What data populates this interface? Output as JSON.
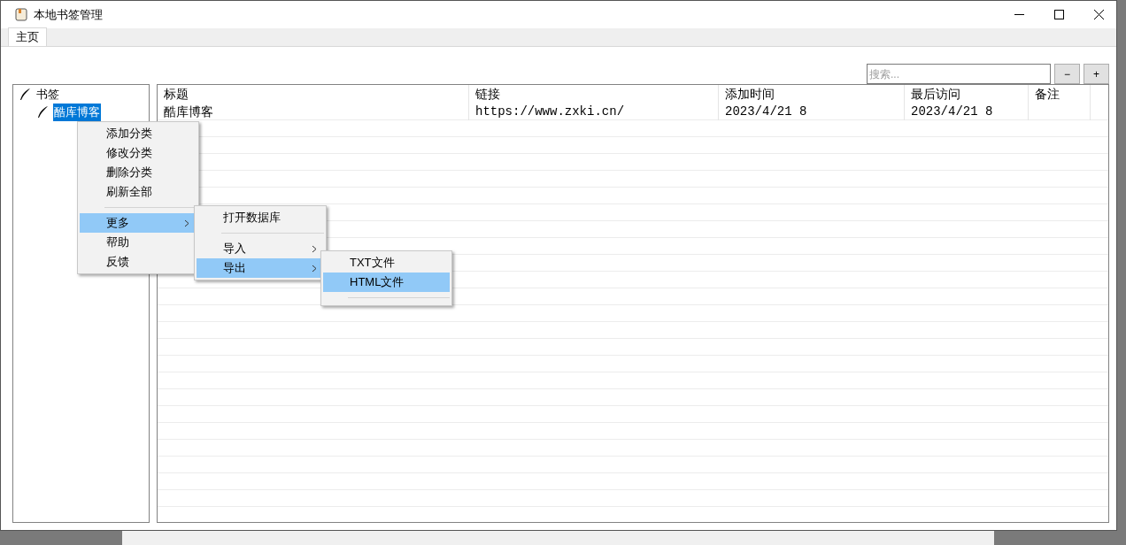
{
  "window": {
    "title": "本地书签管理"
  },
  "tabs": [
    {
      "label": "主页",
      "selected": true
    }
  ],
  "search": {
    "placeholder": "搜索..."
  },
  "toolbar_buttons": [
    "−",
    "+"
  ],
  "tree": [
    {
      "label": "书签",
      "selected": false,
      "children": [
        {
          "label": "酷库博客",
          "selected": true
        }
      ]
    }
  ],
  "table": {
    "columns": [
      "标题",
      "链接",
      "添加时间",
      "最后访问",
      "备注"
    ],
    "rows": [
      [
        "酷库博客",
        "https://www.zxki.cn/",
        "2023/4/21 8",
        "2023/4/21 8",
        ""
      ]
    ]
  },
  "context_menu": [
    {
      "label": "添加分类",
      "selected": false
    },
    {
      "label": "修改分类",
      "selected": false
    },
    {
      "label": "删除分类",
      "selected": false
    },
    {
      "label": "刷新全部",
      "selected": false
    },
    {
      "kind": "separator"
    },
    {
      "label": "更多",
      "selected": true,
      "submenu": true
    },
    {
      "label": "帮助",
      "selected": false
    },
    {
      "label": "反馈",
      "selected": false
    }
  ],
  "submenu_more": [
    {
      "label": "打开数据库",
      "selected": false
    },
    {
      "kind": "separator"
    },
    {
      "label": "导入",
      "selected": false,
      "submenu": true
    },
    {
      "label": "导出",
      "selected": true,
      "submenu": true
    }
  ],
  "submenu_export": [
    {
      "label": "TXT文件",
      "selected": false
    },
    {
      "label": "HTML文件",
      "selected": true
    },
    {
      "kind": "separator"
    }
  ]
}
